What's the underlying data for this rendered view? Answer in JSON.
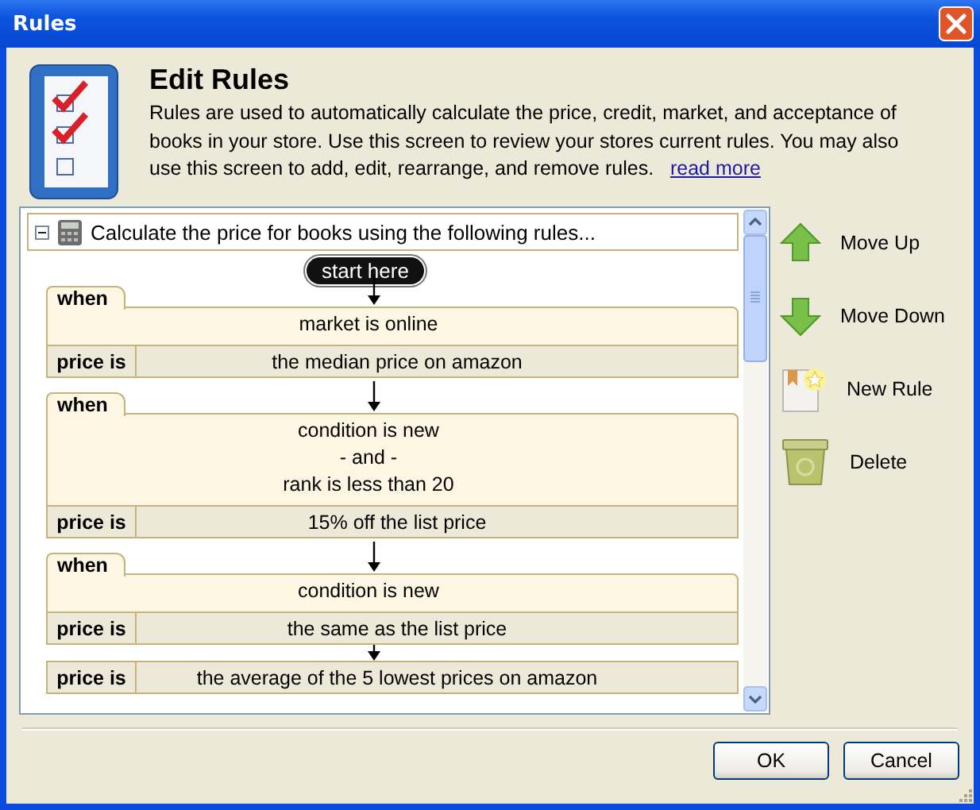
{
  "window": {
    "title": "Rules"
  },
  "header": {
    "title": "Edit Rules",
    "description": "Rules are used to automatically calculate the price, credit, market, and acceptance of books in your store. Use this screen to review your stores current rules. You may also use this screen to add, edit, rearrange, and remove rules.",
    "link": "read more"
  },
  "rule_set": {
    "title": "Calculate the price for books using the following rules...",
    "expanded": true,
    "start": "start here",
    "rules": [
      {
        "kind": "conditional",
        "when_label": "when",
        "conditions": [
          "market is online"
        ],
        "result_label": "price is",
        "result": "the median price on amazon"
      },
      {
        "kind": "conditional",
        "when_label": "when",
        "conditions": [
          "condition is new",
          "- and -",
          "rank is less than 20"
        ],
        "result_label": "price is",
        "result": "15% off the list price"
      },
      {
        "kind": "conditional",
        "when_label": "when",
        "conditions": [
          "condition is new"
        ],
        "result_label": "price is",
        "result": "the same as the list price"
      },
      {
        "kind": "default",
        "result_label": "price is",
        "result": "the average of the 5 lowest prices on amazon"
      }
    ]
  },
  "actions": [
    {
      "kind": "up",
      "label": "Move Up"
    },
    {
      "kind": "down",
      "label": "Move Down"
    },
    {
      "kind": "new",
      "label": "New Rule"
    },
    {
      "kind": "delete",
      "label": "Delete"
    }
  ],
  "buttons": [
    "OK",
    "Cancel"
  ]
}
